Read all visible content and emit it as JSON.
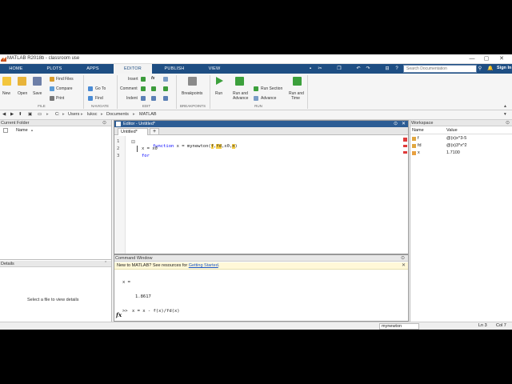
{
  "window": {
    "title": "MATLAB R2018b - classroom use",
    "controls": {
      "minimize": "—",
      "maximize": "▢",
      "close": "✕"
    }
  },
  "tabs": [
    "HOME",
    "PLOTS",
    "APPS",
    "EDITOR",
    "PUBLISH",
    "VIEW"
  ],
  "active_tab": "EDITOR",
  "search": {
    "placeholder": "Search Documentation"
  },
  "signin": "Sign In",
  "ribbon": {
    "file": {
      "new": "New",
      "open": "Open",
      "save": "Save",
      "find_files": "Find Files",
      "compare": "Compare",
      "print": "Print",
      "section": "FILE"
    },
    "navigate": {
      "go_to": "Go To",
      "find": "Find",
      "section": "NAVIGATE"
    },
    "edit": {
      "insert": "Insert",
      "comment": "Comment",
      "indent": "Indent",
      "fx": "fx",
      "section": "EDIT"
    },
    "breakpoints": {
      "label": "Breakpoints",
      "section": "BREAKPOINTS"
    },
    "run": {
      "run": "Run",
      "run_and_advance_1": "Run and",
      "run_and_advance_2": "Advance",
      "run_section": "Run Section",
      "advance": "Advance",
      "run_and_time_1": "Run and",
      "run_and_time_2": "Time",
      "section": "RUN"
    }
  },
  "address": {
    "path": [
      "C:",
      "Users",
      "luksc",
      "Documents",
      "MATLAB"
    ]
  },
  "current_folder": {
    "title": "Current Folder",
    "column": "Name",
    "sort": "▲"
  },
  "details": {
    "title": "Details",
    "empty_text": "Select a file to view details"
  },
  "editor": {
    "title": "Editor - Untitled*",
    "tab": "Untitled*",
    "add_tab": "+",
    "lines": [
      {
        "num": "1",
        "parts": [
          {
            "t": "function",
            "kw": true
          },
          {
            "t": " x = mynewton(",
            "kw": false
          },
          {
            "t": "f",
            "kw": false
          },
          {
            "t": ",",
            "kw": false
          },
          {
            "t": "fd",
            "kw": false
          },
          {
            "t": ",x0,",
            "kw": false
          },
          {
            "t": "n",
            "kw": false
          },
          {
            "t": ")",
            "kw": false
          }
        ]
      },
      {
        "num": "2",
        "parts": [
          {
            "t": "x = x0",
            "kw": false
          }
        ]
      },
      {
        "num": "3",
        "parts": [
          {
            "t": "for",
            "kw": true
          }
        ]
      }
    ]
  },
  "command_window": {
    "title": "Command Window",
    "notice": "New to MATLAB? See resources for ",
    "notice_link": "Getting Started",
    "notice_end": ".",
    "output_var": "x =",
    "output_val": "1.8617",
    "prompt": ">>",
    "input": "x = x - f(x)/fd(x)",
    "fx": "fx"
  },
  "workspace": {
    "title": "Workspace",
    "columns": [
      "Name",
      "Value"
    ],
    "rows": [
      {
        "name": "f",
        "value": "@(x)x^3-5"
      },
      {
        "name": "fd",
        "value": "@(x)3*x^2"
      },
      {
        "name": "x",
        "value": "1.7100"
      }
    ]
  },
  "status": {
    "function_name": "mynewton",
    "ln": "Ln  3",
    "col": "Col  7"
  },
  "colors": {
    "tab_bar": "#1e4e83",
    "keyword": "#0000ff",
    "highlight": "#f7ce46"
  }
}
